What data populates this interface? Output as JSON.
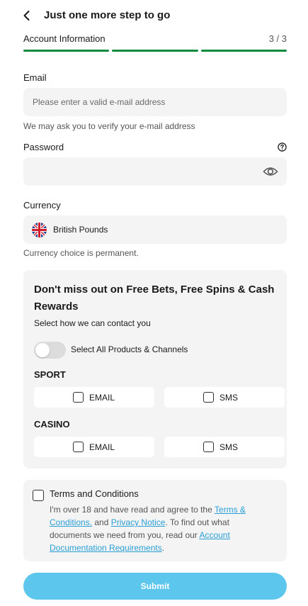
{
  "header": {
    "title": "Just one more step to go",
    "back_icon": "chevron-left-icon"
  },
  "progress": {
    "label": "Account Information",
    "count": "3 / 3",
    "steps_completed": 3,
    "steps_total": 3,
    "color": "#0e8a3c"
  },
  "email": {
    "label": "Email",
    "placeholder": "Please enter a valid e-mail address",
    "value": "",
    "hint": "We may ask you to verify your e-mail address"
  },
  "password": {
    "label": "Password",
    "value": "",
    "help_icon": "question-circle-icon",
    "toggle_icon": "eye-icon"
  },
  "currency": {
    "label": "Currency",
    "value": "British Pounds",
    "flag_icon": "uk-flag-icon",
    "hint": "Currency choice is permanent."
  },
  "marketing": {
    "title": "Don't miss out on Free Bets, Free Spins & Cash Rewards",
    "subtitle": "Select how we can contact you",
    "select_all_label": "Select All Products & Channels",
    "select_all_on": false,
    "sections": [
      {
        "title": "SPORT",
        "options": [
          {
            "label": "EMAIL",
            "checked": false
          },
          {
            "label": "SMS",
            "checked": false
          }
        ]
      },
      {
        "title": "CASINO",
        "options": [
          {
            "label": "EMAIL",
            "checked": false
          },
          {
            "label": "SMS",
            "checked": false
          }
        ]
      }
    ]
  },
  "terms": {
    "title": "Terms and Conditions",
    "checked": false,
    "text_1": "I'm over 18 and have read and agree to the ",
    "link_terms": "Terms & Conditions.",
    "text_2": " and ",
    "link_privacy": "Privacy Notice",
    "text_3": ". To find out what documents we need from you, read our ",
    "link_docs": "Account Documentation Requirements",
    "text_4": "."
  },
  "submit": {
    "label": "Submit",
    "color": "#5cc6ec"
  }
}
